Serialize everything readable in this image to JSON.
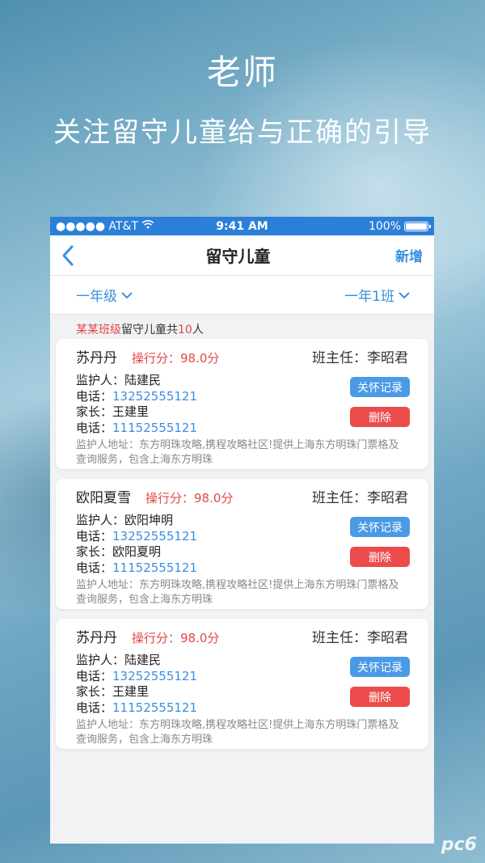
{
  "hero": {
    "title": "老师",
    "subtitle": "关注留守儿童给与正确的引导"
  },
  "status_bar": {
    "carrier": "●●●●● AT&T",
    "time": "9:41 AM",
    "battery": "100%"
  },
  "nav": {
    "back_icon": "chevron-left-icon",
    "title": "留守儿童",
    "add_label": "新增"
  },
  "filters": {
    "grade": "一年级",
    "class": "一年1班"
  },
  "summary": {
    "class_name": "某某班级",
    "middle": "留守儿童共",
    "count": "10",
    "suffix": "人"
  },
  "cards": [
    {
      "name": "苏丹丹",
      "score": "操行分：98.0分",
      "teacher": "班主任：李昭君",
      "guardian_label": "监护人：",
      "guardian": "陆建民",
      "phone_label": "电话：",
      "guardian_phone": "13252555121",
      "parent_label": "家长：",
      "parent": "王建里",
      "parent_phone_label": "电话：",
      "parent_phone": "11152555121",
      "address": "监护人地址：东方明珠攻略,携程攻略社区!提供上海东方明珠门票格及查询服务，包含上海东方明珠",
      "care_button": "关怀记录",
      "delete_button": "删除"
    },
    {
      "name": "欧阳夏雪",
      "score": "操行分：98.0分",
      "teacher": "班主任：李昭君",
      "guardian_label": "监护人：",
      "guardian": "欧阳坤明",
      "phone_label": "电话：",
      "guardian_phone": "13252555121",
      "parent_label": "家长：",
      "parent": "欧阳夏明",
      "parent_phone_label": "电话：",
      "parent_phone": "11152555121",
      "address": "监护人地址：东方明珠攻略,携程攻略社区!提供上海东方明珠门票格及查询服务，包含上海东方明珠",
      "care_button": "关怀记录",
      "delete_button": "删除"
    },
    {
      "name": "苏丹丹",
      "score": "操行分：98.0分",
      "teacher": "班主任：李昭君",
      "guardian_label": "监护人：",
      "guardian": "陆建民",
      "phone_label": "电话：",
      "guardian_phone": "13252555121",
      "parent_label": "家长：",
      "parent": "王建里",
      "parent_phone_label": "电话：",
      "parent_phone": "11152555121",
      "address": "监护人地址：东方明珠攻略,携程攻略社区!提供上海东方明珠门票格及查询服务，包含上海东方明珠",
      "care_button": "关怀记录",
      "delete_button": "删除"
    }
  ],
  "watermark": "pc6",
  "colors": {
    "accent": "#3a8fe0",
    "status_bar": "#2b7fd8",
    "danger": "#ec4b4b",
    "score": "#e24848"
  }
}
